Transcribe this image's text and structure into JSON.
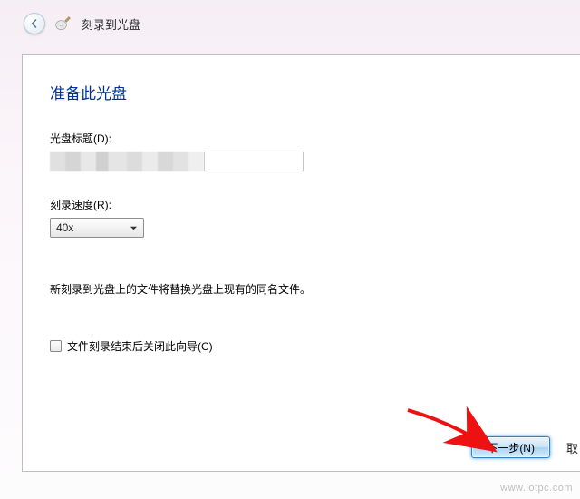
{
  "header": {
    "title": "刻录到光盘"
  },
  "heading": "准备此光盘",
  "disc_title": {
    "label": "光盘标题(D):",
    "value": ""
  },
  "burn_speed": {
    "label": "刻录速度(R):",
    "selected": "40x"
  },
  "note": "新刻录到光盘上的文件将替换光盘上现有的同名文件。",
  "close_wizard": {
    "label": "文件刻录结束后关闭此向导(C)",
    "checked": false
  },
  "buttons": {
    "next": "下一步(N)",
    "cancel": "取"
  },
  "watermark": "www.lotpc.com"
}
